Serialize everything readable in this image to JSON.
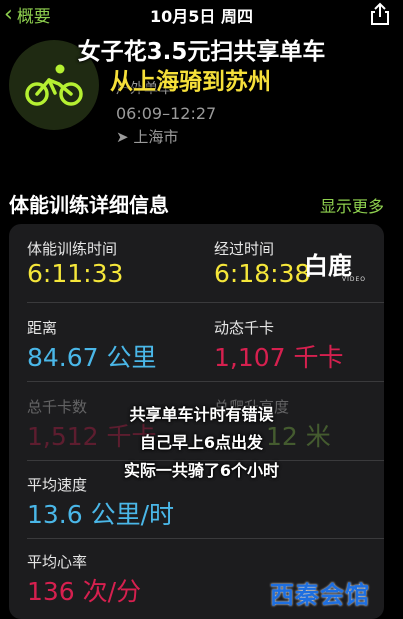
{
  "nav": {
    "back_label": "概要",
    "date": "10月5日 周四"
  },
  "overlay": {
    "title_line1": "女子花3.5元扫共享单车",
    "title_line2": "从上海骑到苏州",
    "middle_lines": [
      "共享单车计时有错误",
      "自己早上6点出发",
      "实际一共骑了6个小时"
    ]
  },
  "workout": {
    "type": "户外单车",
    "time_range": "06:09–12:27",
    "location": "上海市"
  },
  "section": {
    "title": "体能训练详细信息",
    "show_more": "显示更多"
  },
  "metrics": {
    "workout_time_label": "体能训练时间",
    "workout_time": "6:11:33",
    "elapsed_time_label": "经过时间",
    "elapsed_time": "6:18:38",
    "distance_label": "距离",
    "distance": "84.67 公里",
    "active_kcal_label": "动态千卡",
    "active_kcal": "1,107 千卡",
    "total_kcal_label": "总千卡数",
    "total_kcal": "1,512 千卡",
    "elevation_label": "总爬升高度",
    "elevation": "12 米",
    "avg_speed_label": "平均速度",
    "avg_speed": "13.6 公里/时",
    "avg_hr_label": "平均心率",
    "avg_hr": "136 次/分"
  },
  "watermarks": {
    "top": "白鹿",
    "top_sub": "VIDEO",
    "bottom": "西秦会馆"
  },
  "colors": {
    "accent": "#8fd14f",
    "time": "#f5e63a",
    "distance": "#4ab7e8",
    "calories": "#d6204f"
  }
}
